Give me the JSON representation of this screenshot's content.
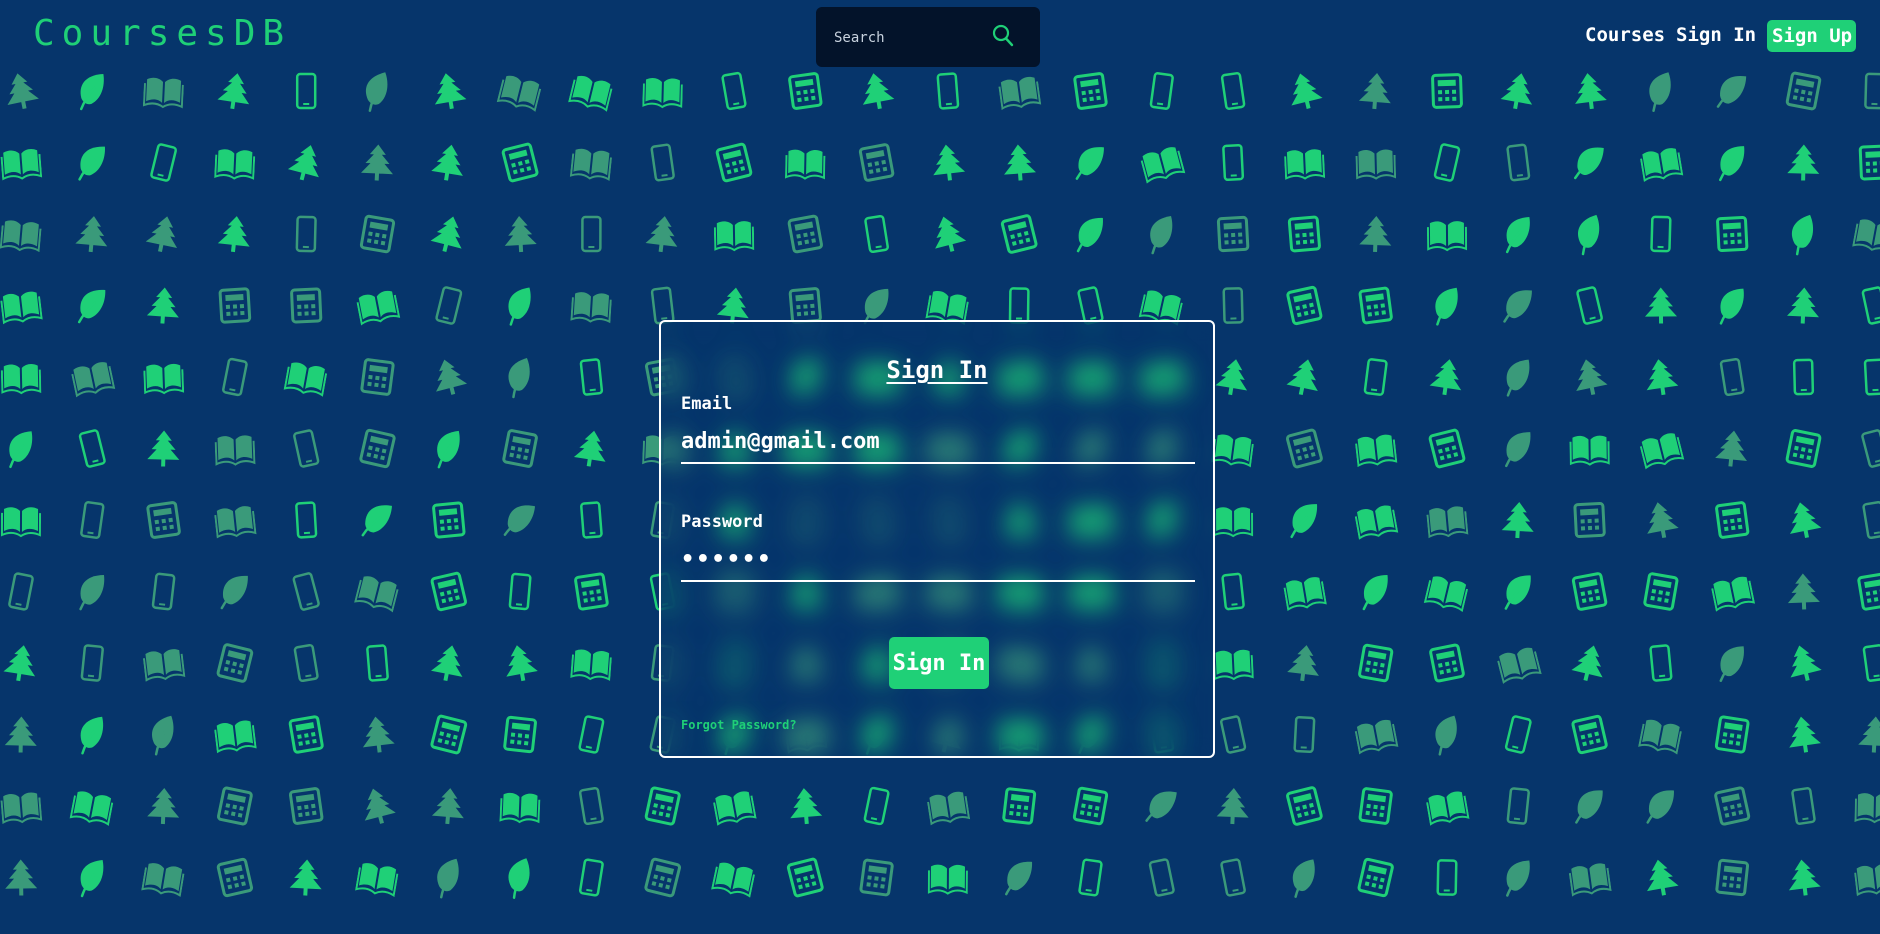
{
  "app": {
    "logo": "CoursesDB"
  },
  "header": {
    "search": {
      "placeholder": "Search",
      "icon": "search-icon"
    },
    "nav": {
      "courses": "Courses",
      "sign_in": "Sign In",
      "sign_up": "Sign Up"
    }
  },
  "background": {
    "icons": [
      "book-icon",
      "leaf-icon",
      "tree-icon",
      "phone-icon",
      "calculator-icon"
    ]
  },
  "form": {
    "title": "Sign In",
    "email_label": "Email",
    "email_value": "admin@gmail.com",
    "password_label": "Password",
    "password_value": "••••••",
    "submit_label": "Sign In",
    "forgot_label": "Forgot Password?"
  },
  "colors": {
    "background": "#06356b",
    "accent": "#1fd077",
    "accent_dim": "#3a9a7a",
    "search_bg": "#03132a",
    "text": "#ffffff"
  }
}
